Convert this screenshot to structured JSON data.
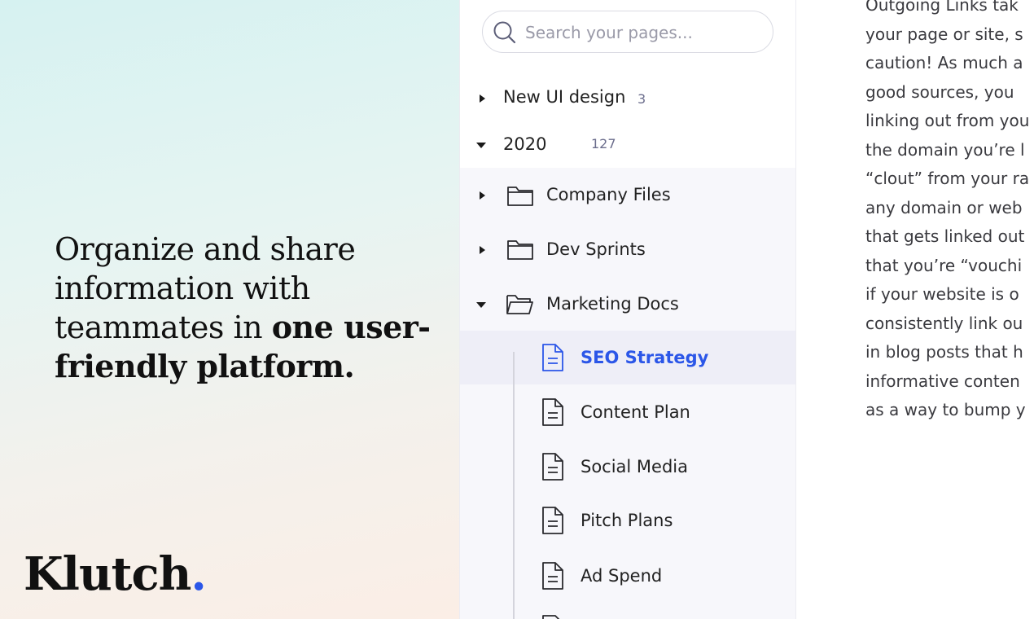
{
  "hero": {
    "tagline_normal": "Organize and share information with teammates in ",
    "tagline_bold": "one user-friendly platform.",
    "logo_text": "Klutch",
    "logo_dot": ".",
    "accent_color": "#2b56e8"
  },
  "search": {
    "placeholder": "Search your pages...",
    "icon": "search-icon"
  },
  "tree": {
    "new_ui_design": {
      "label": "New UI design",
      "count": "3",
      "expanded": false
    },
    "year_2020": {
      "label": "2020",
      "count": "127",
      "expanded": true
    },
    "folders": [
      {
        "label": "Company Files",
        "expanded": false
      },
      {
        "label": "Dev Sprints",
        "expanded": false
      },
      {
        "label": "Marketing Docs",
        "expanded": true
      }
    ],
    "documents": [
      {
        "label": "SEO Strategy",
        "active": true
      },
      {
        "label": "Content Plan",
        "active": false
      },
      {
        "label": "Social Media",
        "active": false
      },
      {
        "label": "Pitch Plans",
        "active": false
      },
      {
        "label": "Ad Spend",
        "active": false
      }
    ],
    "active_color": "#2b56e8"
  },
  "content": {
    "lines": [
      "Outgoing Links tak",
      "your page or site, s",
      "caution! As much a",
      "good sources, you",
      "linking out from you",
      "the domain you’re l",
      "“clout” from your ra",
      "any domain or web",
      "that gets linked out",
      "that you’re “vouchi",
      "if your website is o",
      "consistently link ou",
      "in blog posts that h",
      "informative conten",
      "as a way to bump y"
    ]
  }
}
